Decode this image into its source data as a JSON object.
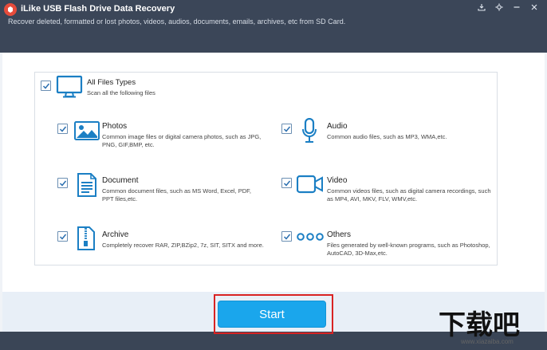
{
  "window": {
    "title": "iLike USB Flash Drive Data Recovery",
    "subtitle": "Recover deleted, formatted or lost photos, videos, audios, documents, emails, archives, etc from SD Card."
  },
  "all_files": {
    "title": "All Files Types",
    "desc": "Scan all the following files",
    "checked": true
  },
  "items": [
    {
      "title": "Photos",
      "desc": "Common image files or digital camera photos, such as JPG, PNG, GIF,BMP, etc.",
      "icon": "image-icon",
      "checked": true
    },
    {
      "title": "Audio",
      "desc": "Common audio files, such as MP3, WMA,etc.",
      "icon": "microphone-icon",
      "checked": true
    },
    {
      "title": "Document",
      "desc": "Common document files, such as MS Word, Excel, PDF, PPT files,etc.",
      "icon": "document-icon",
      "checked": true
    },
    {
      "title": "Video",
      "desc": "Common videos files, such as digital camera recordings, such as MP4, AVI, MKV, FLV, WMV,etc.",
      "icon": "video-camera-icon",
      "checked": true
    },
    {
      "title": "Archive",
      "desc": "Completely recover RAR, ZIP,BZip2, 7z, SIT, SITX and more.",
      "icon": "zip-archive-icon",
      "checked": true
    },
    {
      "title": "Others",
      "desc": "Files generated by well-known programs, such as Photoshop, AutoCAD, 3D-Max,etc.",
      "icon": "more-dots-icon",
      "checked": true
    }
  ],
  "start_label": "Start",
  "watermark": {
    "text": "下载吧",
    "url": "www.xiazaiba.com"
  },
  "colors": {
    "titlebar": "#3b4658",
    "accent": "#1aa6ec",
    "icon_blue": "#1b7fc4",
    "highlight_red": "#d92323"
  }
}
